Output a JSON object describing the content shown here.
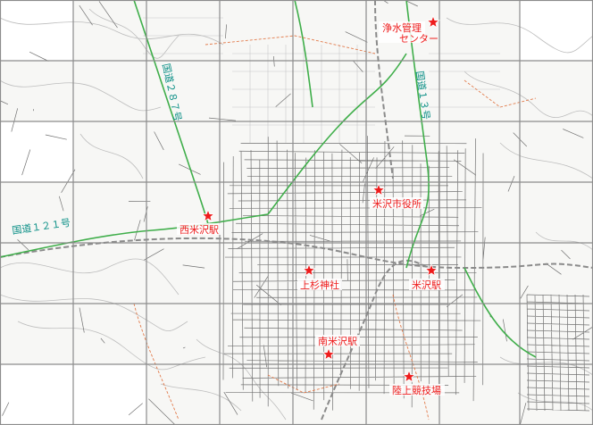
{
  "map": {
    "colors": {
      "grid": "#8c8c8c",
      "road_green": "#3fae4a",
      "road_label": "#0a8f86",
      "marker_red": "#ee1c1c",
      "contour": "#b9b9b9",
      "street": "#6f6f6f",
      "rail": "#999999"
    },
    "road_labels": [
      {
        "id": "route-287",
        "text": "国道２８７号"
      },
      {
        "id": "route-13",
        "text": "国道１３号"
      },
      {
        "id": "route-121",
        "text": "国道１２１号"
      }
    ],
    "landmarks": [
      {
        "id": "water-center",
        "line1": "浄水管理",
        "line2": "センター",
        "icon": "star-marker-icon"
      },
      {
        "id": "city-hall",
        "line1": "米沢市役所",
        "line2": "",
        "icon": "star-marker-icon"
      },
      {
        "id": "nishi-yonezawa",
        "line1": "西米沢駅",
        "line2": "",
        "icon": "star-marker-icon"
      },
      {
        "id": "uesugi-shrine",
        "line1": "上杉神社",
        "line2": "",
        "icon": "star-marker-icon"
      },
      {
        "id": "yonezawa-station",
        "line1": "米沢駅",
        "line2": "",
        "icon": "star-marker-icon"
      },
      {
        "id": "minami-yonezawa",
        "line1": "南米沢駅",
        "line2": "",
        "icon": "star-marker-icon"
      },
      {
        "id": "stadium",
        "line1": "陸上競技場",
        "line2": "",
        "icon": "star-marker-icon"
      }
    ]
  }
}
